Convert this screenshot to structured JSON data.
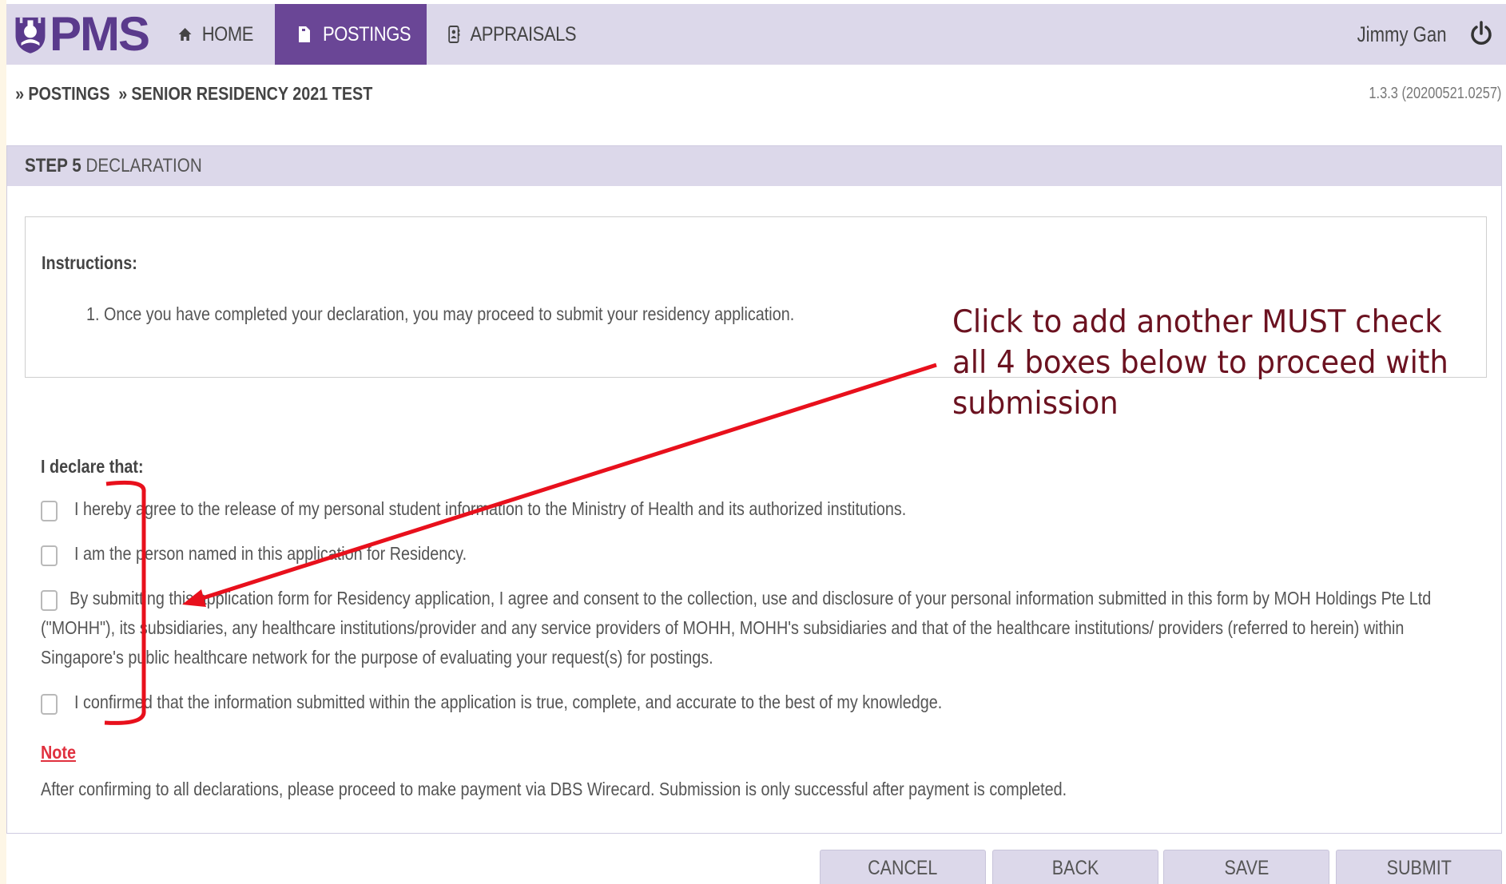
{
  "app": {
    "logo_text": "PMS",
    "user_name": "Jimmy Gan",
    "version": "1.3.3 (20200521.0257)"
  },
  "nav": {
    "items": [
      {
        "label": "HOME",
        "icon": "home-icon",
        "active": false
      },
      {
        "label": "POSTINGS",
        "icon": "document-icon",
        "active": true
      },
      {
        "label": "APPRAISALS",
        "icon": "contact-card-icon",
        "active": false
      }
    ]
  },
  "breadcrumb": {
    "separator": "»",
    "items": [
      "POSTINGS",
      "SENIOR RESIDENCY 2021 TEST"
    ]
  },
  "panel": {
    "step": "STEP 5",
    "title": "DECLARATION",
    "instructions_title": "Instructions:",
    "instructions": [
      "1. Once you have completed your declaration, you may proceed to submit your residency application."
    ],
    "declare_title": "I declare that:",
    "declarations": [
      "I hereby agree to the release of my personal student information to the Ministry of Health and its authorized institutions.",
      "I am the person named in this application for Residency.",
      [
        "By submitting this application form for Residency application, I agree and consent to the collection, use and disclosure of your personal information submitted in this form by MOH Holdings Pte Ltd",
        "(\"MOHH\"), its subsidiaries, any healthcare institutions/provider and any service providers of MOHH, MOHH's subsidiaries and that of the healthcare institutions/ providers (referred to herein) within",
        "Singapore's public healthcare network for the purpose of evaluating your request(s) for postings."
      ],
      "I confirmed that the information submitted within the application is true, complete, and accurate to the best of my knowledge."
    ],
    "note_label": "Note",
    "note_text": "After confirming to all declarations, please proceed to make payment via DBS Wirecard. Submission is only successful after payment is completed."
  },
  "buttons": {
    "cancel": "CANCEL",
    "back": "BACK",
    "save": "SAVE",
    "submit": "SUBMIT"
  },
  "annotation": {
    "lines": [
      "Click to add another MUST check",
      "all 4 boxes below to proceed with",
      "submission"
    ],
    "color": "#e8101c",
    "text_color": "#6b1220"
  },
  "colors": {
    "nav_bg": "#dcd8ea",
    "nav_active": "#6a4696",
    "brand": "#5a3a8c",
    "note_red": "#e0303e"
  }
}
